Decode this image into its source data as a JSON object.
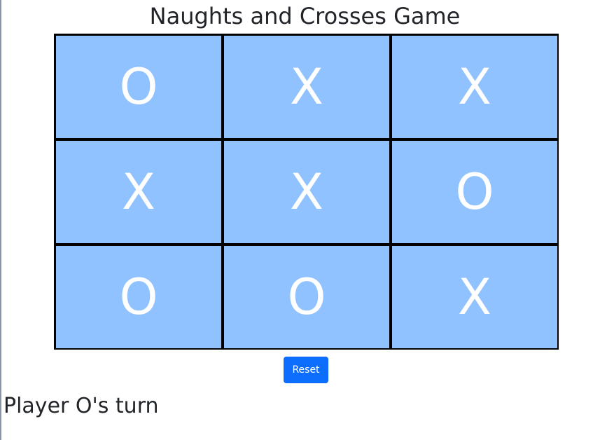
{
  "game": {
    "title": "Naughts and Crosses Game",
    "board": [
      "O",
      "X",
      "X",
      "X",
      "X",
      "O",
      "O",
      "O",
      "X"
    ],
    "reset_label": "Reset",
    "status": "Player O's turn"
  },
  "colors": {
    "cell_background": "#90c2ff",
    "mark": "#ffffff",
    "grid_lines": "#000000",
    "button": "#0d6efd",
    "text": "#212529"
  }
}
